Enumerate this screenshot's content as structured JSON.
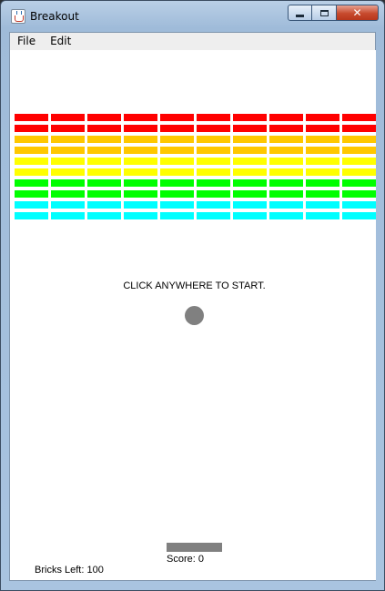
{
  "window": {
    "title": "Breakout",
    "close_glyph": "✕"
  },
  "menu": {
    "items": [
      "File",
      "Edit"
    ]
  },
  "game": {
    "message": "CLICK ANYWHERE TO START.",
    "score_text": "Score: 0",
    "bricks_left_text": "Bricks Left: 100",
    "brick_columns": 10,
    "brick_rows": [
      {
        "color": "#ff0000"
      },
      {
        "color": "#ff0000"
      },
      {
        "color": "#ffc800"
      },
      {
        "color": "#ffc800"
      },
      {
        "color": "#ffff00"
      },
      {
        "color": "#ffff00"
      },
      {
        "color": "#00ff00"
      },
      {
        "color": "#00ff00"
      },
      {
        "color": "#00ffff"
      },
      {
        "color": "#00ffff"
      }
    ],
    "ball_color": "#808080",
    "paddle_color": "#808080"
  }
}
